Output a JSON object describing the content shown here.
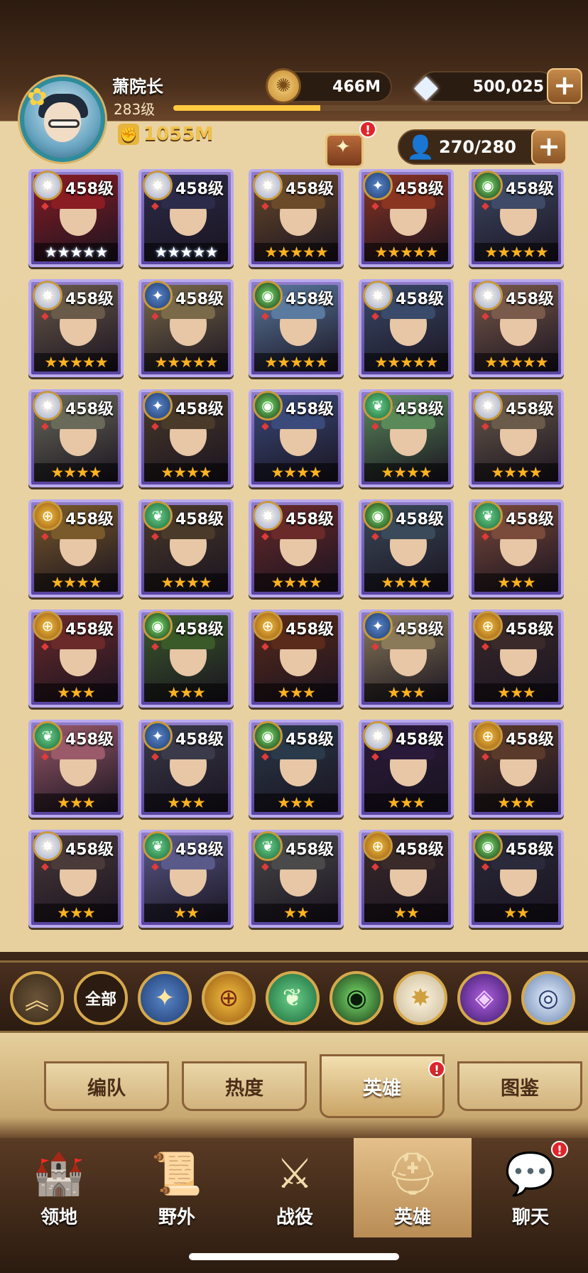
{
  "player": {
    "name": "萧院长",
    "level": "283级",
    "power": "1055M",
    "xp_fraction": 0.37
  },
  "resources": {
    "gold": "466M",
    "diamonds": "500,025",
    "hero_capacity": "270/280"
  },
  "header_badge": "!",
  "colors": {
    "accent_gold": "#f0c24b",
    "card_border": "#b9a9ee",
    "star_gold": "#ffb21e",
    "badge_red": "#e0242b"
  },
  "heroes": [
    {
      "level": "458级",
      "stars": "★★★★★",
      "star_style": "white",
      "faction": "celestial-icon",
      "art": "#8a1c24"
    },
    {
      "level": "458级",
      "stars": "★★★★★",
      "star_style": "white",
      "faction": "celestial-icon",
      "art": "#2c2c4a"
    },
    {
      "level": "458级",
      "stars": "★★★★★",
      "star_style": "gold",
      "faction": "celestial-icon",
      "art": "#6b4a2a"
    },
    {
      "level": "458级",
      "stars": "★★★★★",
      "star_style": "gold",
      "faction": "lightbearer-icon",
      "art": "#8a3422"
    },
    {
      "level": "458级",
      "stars": "★★★★★",
      "star_style": "gold",
      "faction": "graveborn-icon",
      "art": "#3e4a66"
    },
    {
      "level": "458级",
      "stars": "★★★★★",
      "star_style": "gold",
      "faction": "celestial-icon",
      "art": "#6a5a4a"
    },
    {
      "level": "458级",
      "stars": "★★★★★",
      "star_style": "gold",
      "faction": "lightbearer-icon",
      "art": "#7a6a4a"
    },
    {
      "level": "458级",
      "stars": "★★★★★",
      "star_style": "gold",
      "faction": "graveborn-icon",
      "art": "#5a7aa0"
    },
    {
      "level": "458级",
      "stars": "★★★★★",
      "star_style": "gold",
      "faction": "celestial-icon",
      "art": "#3a4a6a"
    },
    {
      "level": "458级",
      "stars": "★★★★★",
      "star_style": "gold",
      "faction": "celestial-icon",
      "art": "#7a5a4a"
    },
    {
      "level": "458级",
      "stars": "★★★★",
      "star_style": "gold",
      "faction": "celestial-icon",
      "art": "#6a6a5a"
    },
    {
      "level": "458级",
      "stars": "★★★★",
      "star_style": "gold",
      "faction": "lightbearer-icon",
      "art": "#4a3a2a"
    },
    {
      "level": "458级",
      "stars": "★★★★",
      "star_style": "gold",
      "faction": "graveborn-icon",
      "art": "#3a4a7a"
    },
    {
      "level": "458级",
      "stars": "★★★★",
      "star_style": "gold",
      "faction": "wilder-icon",
      "art": "#5a8a5a"
    },
    {
      "level": "458级",
      "stars": "★★★★",
      "star_style": "gold",
      "faction": "celestial-icon",
      "art": "#6a5a4a"
    },
    {
      "level": "458级",
      "stars": "★★★★",
      "star_style": "gold",
      "faction": "maulers-icon",
      "art": "#7a5a2a"
    },
    {
      "level": "458级",
      "stars": "★★★★",
      "star_style": "gold",
      "faction": "wilder-icon",
      "art": "#4a3a2a"
    },
    {
      "level": "458级",
      "stars": "★★★★",
      "star_style": "gold",
      "faction": "celestial-icon",
      "art": "#6a2a2a"
    },
    {
      "level": "458级",
      "stars": "★★★★",
      "star_style": "gold",
      "faction": "graveborn-icon",
      "art": "#3a4a5a"
    },
    {
      "level": "458级",
      "stars": "★★★",
      "star_style": "gold",
      "faction": "wilder-icon",
      "art": "#7a4a3a"
    },
    {
      "level": "458级",
      "stars": "★★★",
      "star_style": "gold",
      "faction": "maulers-icon",
      "art": "#6a2a2a"
    },
    {
      "level": "458级",
      "stars": "★★★",
      "star_style": "gold",
      "faction": "graveborn-icon",
      "art": "#3a5a2a"
    },
    {
      "level": "458级",
      "stars": "★★★",
      "star_style": "gold",
      "faction": "maulers-icon",
      "art": "#5a2a1a"
    },
    {
      "level": "458级",
      "stars": "★★★",
      "star_style": "gold",
      "faction": "lightbearer-icon",
      "art": "#8a7a5a"
    },
    {
      "level": "458级",
      "stars": "★★★",
      "star_style": "gold",
      "faction": "maulers-icon",
      "art": "#3a2a2a"
    },
    {
      "level": "458级",
      "stars": "★★★",
      "star_style": "gold",
      "faction": "wilder-icon",
      "art": "#9a5a6a"
    },
    {
      "level": "458级",
      "stars": "★★★",
      "star_style": "gold",
      "faction": "lightbearer-icon",
      "art": "#3a3a4a"
    },
    {
      "level": "458级",
      "stars": "★★★",
      "star_style": "gold",
      "faction": "graveborn-icon",
      "art": "#2a3a4a"
    },
    {
      "level": "458级",
      "stars": "★★★",
      "star_style": "gold",
      "faction": "celestial-icon",
      "art": "#2a1a3a"
    },
    {
      "level": "458级",
      "stars": "★★★",
      "star_style": "gold",
      "faction": "maulers-icon",
      "art": "#5a3a2a"
    },
    {
      "level": "458级",
      "stars": "★★★",
      "star_style": "gold",
      "faction": "celestial-icon",
      "art": "#4a3a3a"
    },
    {
      "level": "458级",
      "stars": "★★",
      "star_style": "gold",
      "faction": "wilder-icon",
      "art": "#5a5a8a"
    },
    {
      "level": "458级",
      "stars": "★★",
      "star_style": "gold",
      "faction": "wilder-icon",
      "art": "#4a4a4a"
    },
    {
      "level": "458级",
      "stars": "★★",
      "star_style": "gold",
      "faction": "maulers-icon",
      "art": "#3a2a2a"
    },
    {
      "level": "458级",
      "stars": "★★",
      "star_style": "gold",
      "faction": "graveborn-icon",
      "art": "#2a2a3a"
    }
  ],
  "faction_filter": {
    "collapse_icon": "chevron-up-icon",
    "all_label": "全部",
    "factions": [
      "lightbearer-icon",
      "maulers-icon",
      "wilder-icon",
      "graveborn-icon",
      "celestial-icon",
      "hypogean-icon",
      "dimensional-icon"
    ]
  },
  "tabs": [
    {
      "label": "编队"
    },
    {
      "label": "热度"
    },
    {
      "label": "英雄",
      "badge": "!"
    },
    {
      "label": "图鉴"
    }
  ],
  "nav": [
    {
      "label": "领地",
      "icon": "castle-icon"
    },
    {
      "label": "野外",
      "icon": "map-scroll-icon"
    },
    {
      "label": "战役",
      "icon": "battle-crest-icon"
    },
    {
      "label": "英雄",
      "icon": "knight-helmet-icon"
    },
    {
      "label": "聊天",
      "icon": "chat-bubble-icon",
      "badge": "!"
    }
  ]
}
